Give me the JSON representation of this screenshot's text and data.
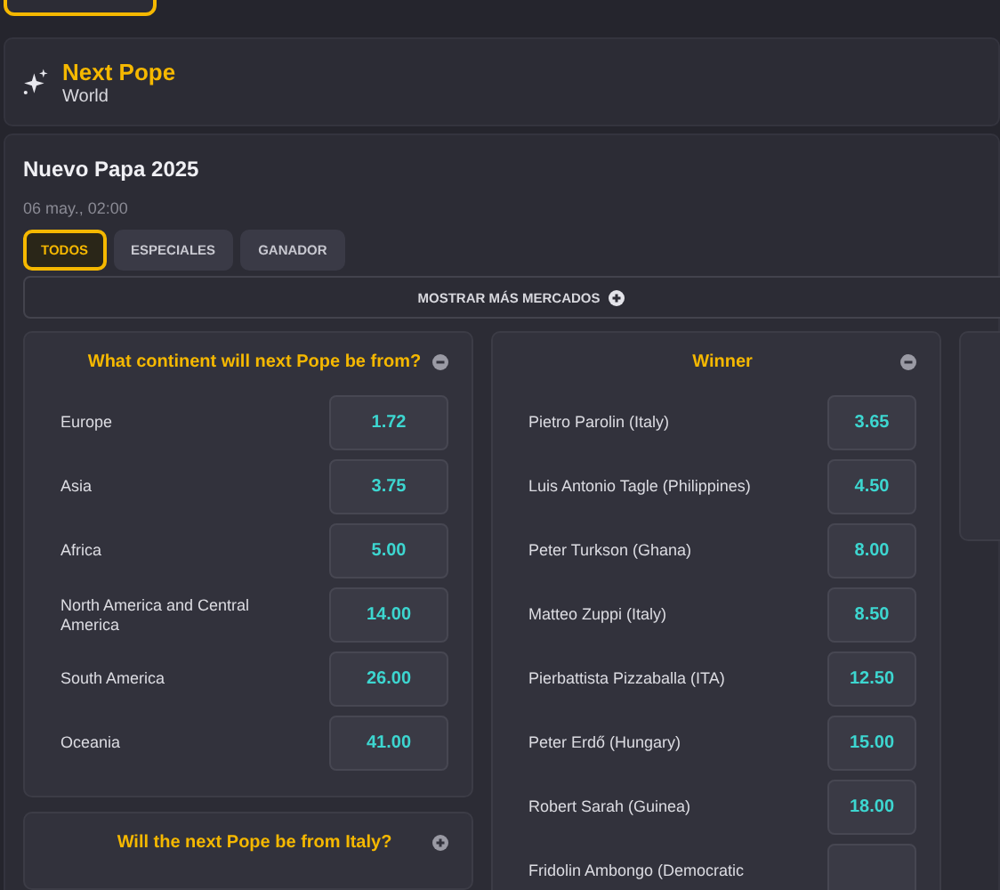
{
  "event_header": {
    "title": "Next Pope",
    "subtitle": "World"
  },
  "event": {
    "title": "Nuevo Papa 2025",
    "date": "06 may., 02:00"
  },
  "tabs": [
    {
      "label": "TODOS",
      "selected": true
    },
    {
      "label": "ESPECIALES",
      "selected": false
    },
    {
      "label": "GANADOR",
      "selected": false
    }
  ],
  "more_markets": {
    "label": "MOSTRAR MÁS MERCADOS"
  },
  "columns": [
    {
      "markets": [
        {
          "title": "What continent will next Pope be from?",
          "expanded": true,
          "outcomes": [
            {
              "name": "Europe",
              "odds": "1.72"
            },
            {
              "name": "Asia",
              "odds": "3.75"
            },
            {
              "name": "Africa",
              "odds": "5.00"
            },
            {
              "name": "North America and Central America",
              "odds": "14.00"
            },
            {
              "name": "South America",
              "odds": "26.00"
            },
            {
              "name": "Oceania",
              "odds": "41.00"
            }
          ]
        },
        {
          "title": "Will the next Pope be from Italy?",
          "expanded": false
        }
      ]
    },
    {
      "markets": [
        {
          "title": "Winner",
          "expanded": true,
          "outcomes": [
            {
              "name": "Pietro Parolin (Italy)",
              "odds": "3.65"
            },
            {
              "name": "Luis Antonio Tagle (Philippines)",
              "odds": "4.50"
            },
            {
              "name": "Peter Turkson (Ghana)",
              "odds": "8.00"
            },
            {
              "name": "Matteo Zuppi (Italy)",
              "odds": "8.50"
            },
            {
              "name": "Pierbattista Pizzaballa (ITA)",
              "odds": "12.50"
            },
            {
              "name": "Peter Erdő (Hungary)",
              "odds": "15.00"
            },
            {
              "name": "Robert Sarah (Guinea)",
              "odds": "18.00"
            },
            {
              "name": "Fridolin Ambongo (Democratic"
            }
          ]
        }
      ]
    }
  ]
}
